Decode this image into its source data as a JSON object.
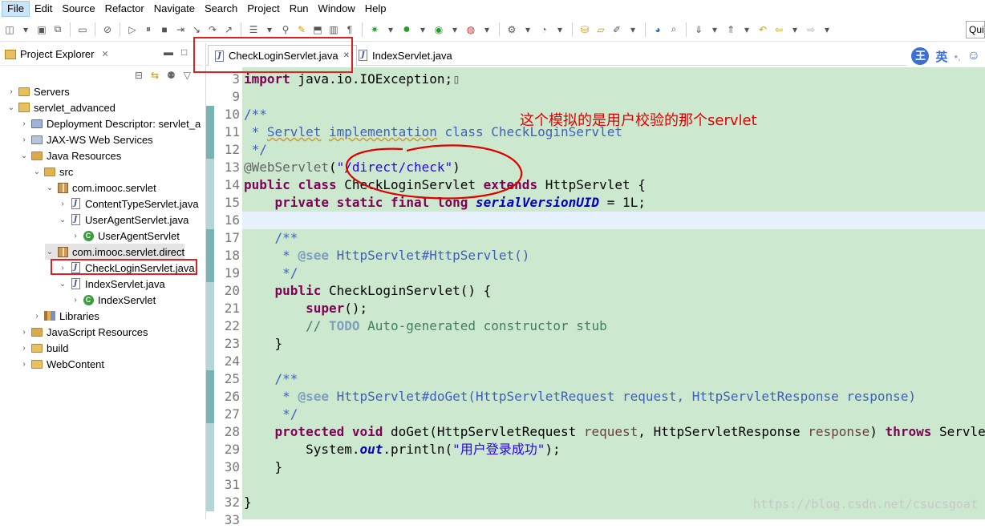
{
  "menu": [
    "File",
    "Edit",
    "Source",
    "Refactor",
    "Navigate",
    "Search",
    "Project",
    "Run",
    "Window",
    "Help"
  ],
  "quick_access": "Qui",
  "project_explorer": {
    "title": "Project Explorer",
    "tree": [
      {
        "label": "Servers",
        "icon": "folder-icon",
        "arrow": "›",
        "depth": 0
      },
      {
        "label": "servlet_advanced",
        "icon": "project-icon",
        "arrow": "⌄",
        "depth": 0
      },
      {
        "label": "Deployment Descriptor: servlet_a",
        "icon": "descriptor-icon",
        "arrow": "›",
        "depth": 1
      },
      {
        "label": "JAX-WS Web Services",
        "icon": "webservice-icon",
        "arrow": "›",
        "depth": 1
      },
      {
        "label": "Java Resources",
        "icon": "java-resources-icon",
        "arrow": "⌄",
        "depth": 1
      },
      {
        "label": "src",
        "icon": "src-folder-icon",
        "arrow": "⌄",
        "depth": 2
      },
      {
        "label": "com.imooc.servlet",
        "icon": "package-icon",
        "arrow": "⌄",
        "depth": 3
      },
      {
        "label": "ContentTypeServlet.java",
        "icon": "java-file-icon",
        "arrow": "›",
        "depth": 4
      },
      {
        "label": "UserAgentServlet.java",
        "icon": "java-file-icon",
        "arrow": "⌄",
        "depth": 4
      },
      {
        "label": "UserAgentServlet",
        "icon": "class-icon",
        "arrow": "›",
        "depth": 5
      },
      {
        "label": "com.imooc.servlet.direct",
        "icon": "package-icon",
        "arrow": "⌄",
        "depth": 3
      },
      {
        "label": "CheckLoginServlet.java",
        "icon": "java-file-icon",
        "arrow": "›",
        "depth": 4
      },
      {
        "label": "IndexServlet.java",
        "icon": "java-file-icon",
        "arrow": "⌄",
        "depth": 4
      },
      {
        "label": "IndexServlet",
        "icon": "class-icon",
        "arrow": "›",
        "depth": 5
      },
      {
        "label": "Libraries",
        "icon": "libraries-icon",
        "arrow": "›",
        "depth": 2
      },
      {
        "label": "JavaScript Resources",
        "icon": "js-resources-icon",
        "arrow": "›",
        "depth": 1
      },
      {
        "label": "build",
        "icon": "folder-icon",
        "arrow": "›",
        "depth": 1
      },
      {
        "label": "WebContent",
        "icon": "folder-icon",
        "arrow": "›",
        "depth": 1
      }
    ]
  },
  "editor": {
    "tabs": [
      {
        "label": "CheckLoginServlet.java",
        "close": "✕"
      },
      {
        "label": "IndexServlet.java"
      }
    ],
    "ime": {
      "badge": "王",
      "text": "英"
    },
    "annotation": "这个模拟的是用户校验的那个servlet",
    "watermark": "https://blog.csdn.net/csucsgoat",
    "line_numbers": [
      "3",
      "9",
      "10",
      "11",
      "12",
      "13",
      "14",
      "15",
      "16",
      "17",
      "18",
      "19",
      "20",
      "21",
      "22",
      "23",
      "24",
      "25",
      "26",
      "27",
      "28",
      "29",
      "30",
      "31",
      "32",
      "33"
    ],
    "lines": [
      [
        {
          "t": "import",
          "c": "kw"
        },
        {
          "t": " java.io.IOException;"
        },
        {
          "t": "▯",
          "c": "an"
        }
      ],
      [],
      [
        {
          "t": "/**",
          "c": "cm"
        }
      ],
      [
        {
          "t": " * ",
          "c": "cm"
        },
        {
          "t": "Servlet",
          "c": "cm ul"
        },
        {
          "t": " ",
          "c": "cm"
        },
        {
          "t": "implementation",
          "c": "cm ul"
        },
        {
          "t": " class CheckLoginServlet",
          "c": "cm"
        }
      ],
      [
        {
          "t": " */",
          "c": "cm"
        }
      ],
      [
        {
          "t": "@WebServlet",
          "c": "an"
        },
        {
          "t": "("
        },
        {
          "t": "\"/direct/check\"",
          "c": "st"
        },
        {
          "t": ")"
        }
      ],
      [
        {
          "t": "public",
          "c": "kw"
        },
        {
          "t": " "
        },
        {
          "t": "class",
          "c": "kw"
        },
        {
          "t": " CheckLoginServlet "
        },
        {
          "t": "extends",
          "c": "kw"
        },
        {
          "t": " HttpServlet {"
        }
      ],
      [
        {
          "t": "    "
        },
        {
          "t": "private",
          "c": "kw"
        },
        {
          "t": " "
        },
        {
          "t": "static",
          "c": "kw"
        },
        {
          "t": " "
        },
        {
          "t": "final",
          "c": "kw"
        },
        {
          "t": " "
        },
        {
          "t": "long",
          "c": "kw"
        },
        {
          "t": " "
        },
        {
          "t": "serialVersionUID",
          "c": "fld"
        },
        {
          "t": " = 1L;"
        }
      ],
      [],
      [
        {
          "t": "    "
        },
        {
          "t": "/**",
          "c": "cm"
        }
      ],
      [
        {
          "t": "     * ",
          "c": "cm"
        },
        {
          "t": "@see",
          "c": "tag"
        },
        {
          "t": " HttpServlet#HttpServlet()",
          "c": "cm"
        }
      ],
      [
        {
          "t": "     */",
          "c": "cm"
        }
      ],
      [
        {
          "t": "    "
        },
        {
          "t": "public",
          "c": "kw"
        },
        {
          "t": " CheckLoginServlet() {"
        }
      ],
      [
        {
          "t": "        "
        },
        {
          "t": "super",
          "c": "kw"
        },
        {
          "t": "();"
        }
      ],
      [
        {
          "t": "        "
        },
        {
          "t": "// ",
          "c": "lc"
        },
        {
          "t": "TODO",
          "c": "todo"
        },
        {
          "t": " Auto-generated constructor stub",
          "c": "lc"
        }
      ],
      [
        {
          "t": "    }"
        }
      ],
      [],
      [
        {
          "t": "    "
        },
        {
          "t": "/**",
          "c": "cm"
        }
      ],
      [
        {
          "t": "     * ",
          "c": "cm"
        },
        {
          "t": "@see",
          "c": "tag"
        },
        {
          "t": " HttpServlet#doGet(HttpServletRequest request, HttpServletResponse response)",
          "c": "cm"
        }
      ],
      [
        {
          "t": "     */",
          "c": "cm"
        }
      ],
      [
        {
          "t": "    "
        },
        {
          "t": "protected",
          "c": "kw"
        },
        {
          "t": " "
        },
        {
          "t": "void",
          "c": "kw"
        },
        {
          "t": " doGet(HttpServletRequest "
        },
        {
          "t": "request",
          "c": "par"
        },
        {
          "t": ", HttpServletResponse "
        },
        {
          "t": "response",
          "c": "par"
        },
        {
          "t": ") "
        },
        {
          "t": "throws",
          "c": "kw"
        },
        {
          "t": " ServletException, IOException {"
        }
      ],
      [
        {
          "t": "        System."
        },
        {
          "t": "out",
          "c": "fld"
        },
        {
          "t": ".println("
        },
        {
          "t": "\"用户登录成功\"",
          "c": "st"
        },
        {
          "t": ");"
        }
      ],
      [
        {
          "t": "    }"
        }
      ],
      [],
      [
        {
          "t": "}"
        }
      ],
      []
    ]
  }
}
